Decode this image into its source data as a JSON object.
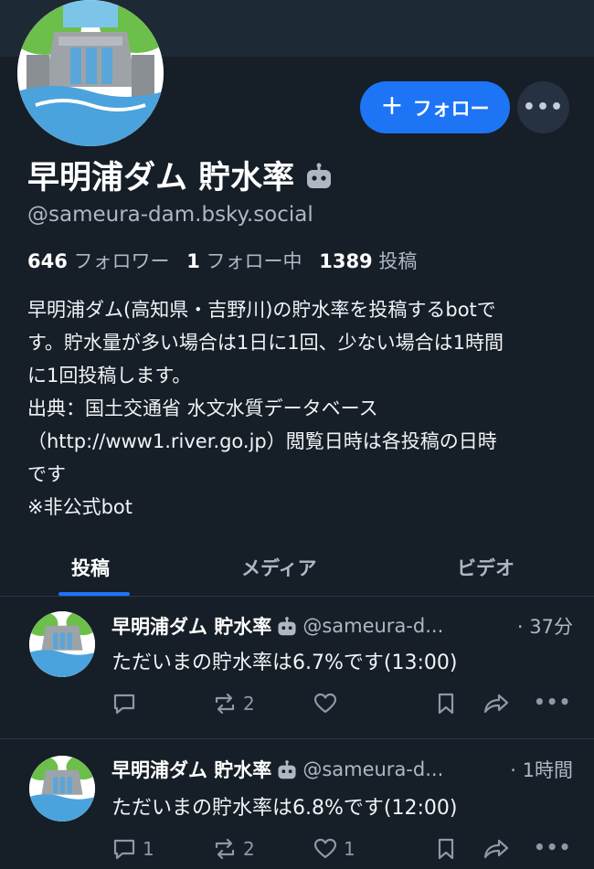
{
  "profile": {
    "display_name": "早明浦ダム 貯水率",
    "handle": "@sameura-dam.bsky.social",
    "bot_icon": "robot-icon",
    "followers_count": "646",
    "followers_label": "フォロワー",
    "following_count": "1",
    "following_label": "フォロー中",
    "posts_count": "1389",
    "posts_label": "投稿",
    "bio_lines": [
      "早明浦ダム(高知県・吉野川)の貯水率を投稿するbotで",
      "す。貯水量が多い場合は1日に1回、少ない場合は1時間",
      "に1回投稿します。",
      "出典：国土交通省 水文水質データベース",
      "（http://www1.river.go.jp）閲覧日時は各投稿の日時",
      "です",
      "※非公式bot"
    ]
  },
  "actions": {
    "follow_label": "フォロー",
    "follow_icon": "plus-icon",
    "more_icon": "ellipsis-icon"
  },
  "tabs": [
    {
      "label": "投稿",
      "active": true
    },
    {
      "label": "メディア",
      "active": false
    },
    {
      "label": "ビデオ",
      "active": false
    }
  ],
  "posts": [
    {
      "name": "早明浦ダム 貯水率",
      "handle": "@sameura-d...",
      "time": "· 37分",
      "text": "ただいまの貯水率は6.7%です(13:00)",
      "reply_count": "",
      "repost_count": "2",
      "like_count": ""
    },
    {
      "name": "早明浦ダム 貯水率",
      "handle": "@sameura-d...",
      "time": "· 1時間",
      "text": "ただいまの貯水率は6.8%です(12:00)",
      "reply_count": "1",
      "repost_count": "2",
      "like_count": "1"
    }
  ],
  "colors": {
    "background": "#161e27",
    "accent": "#1d74f5",
    "muted_text": "#aeb8c3"
  }
}
